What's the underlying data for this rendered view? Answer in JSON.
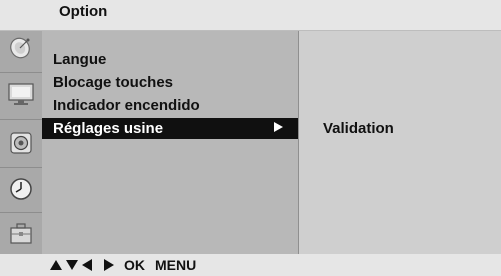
{
  "header": {
    "title": "Option"
  },
  "sidebar_icons": [
    {
      "icon": "satellite-dish-icon"
    },
    {
      "icon": "monitor-picture-icon"
    },
    {
      "icon": "speaker-audio-icon"
    },
    {
      "icon": "clock-time-icon"
    },
    {
      "icon": "option-toolbox-icon"
    }
  ],
  "menu": {
    "items": [
      {
        "label": "Langue"
      },
      {
        "label": "Blocage touches"
      },
      {
        "label": "Indicador encendido"
      },
      {
        "label": "Réglages usine",
        "selected": true
      }
    ]
  },
  "submenu": {
    "label": "Validation"
  },
  "footer": {
    "ok_label": "OK",
    "menu_label": "MENU"
  },
  "colors": {
    "header_bg": "#e6e6e6",
    "icon_strip_bg": "#a9a9a9",
    "menu_panel_bg": "#b8b8b8",
    "submenu_panel_bg": "#cfcfcf",
    "selected_bg": "#101010",
    "selected_text": "#ffffff"
  }
}
